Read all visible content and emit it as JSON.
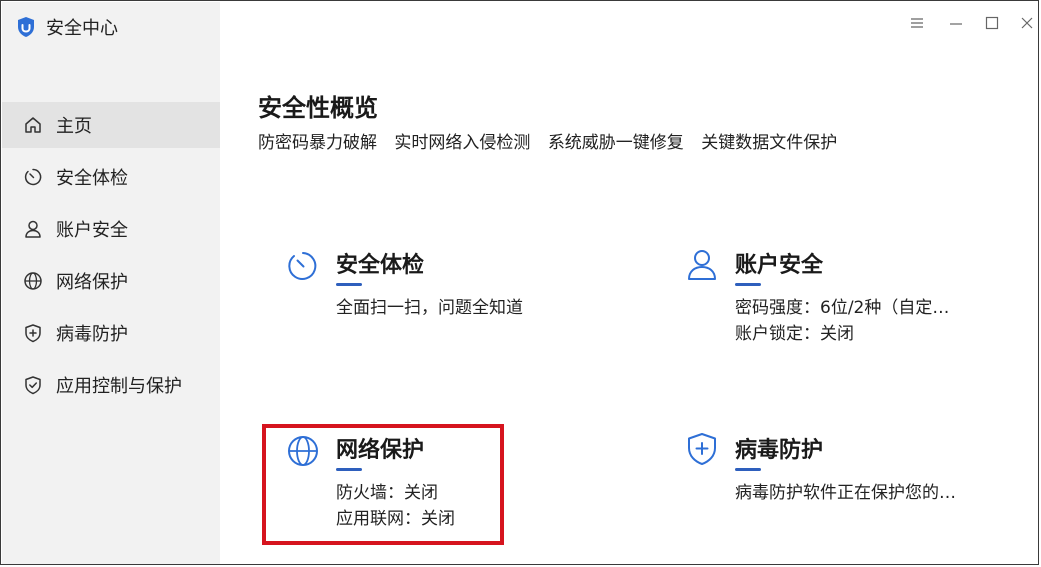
{
  "app": {
    "name": "安全中心"
  },
  "sidebar": {
    "items": [
      {
        "label": "主页",
        "icon": "home-icon",
        "active": true
      },
      {
        "label": "安全体检",
        "icon": "scan-clock-icon",
        "active": false
      },
      {
        "label": "账户安全",
        "icon": "person-icon",
        "active": false
      },
      {
        "label": "网络保护",
        "icon": "globe-icon",
        "active": false
      },
      {
        "label": "病毒防护",
        "icon": "shield-plus-icon",
        "active": false
      },
      {
        "label": "应用控制与保护",
        "icon": "shield-check-icon",
        "active": false
      }
    ]
  },
  "window_controls": [
    "menu-icon",
    "minimize-icon",
    "maximize-icon",
    "close-icon"
  ],
  "main": {
    "title": "安全性概览",
    "features": [
      "防密码暴力破解",
      "实时网络入侵检测",
      "系统威胁一键修复",
      "关键数据文件保护"
    ],
    "cards": {
      "scan": {
        "title": "安全体检",
        "lines": [
          "全面扫一扫，问题全知道"
        ],
        "icon": "scan-clock-icon"
      },
      "account": {
        "title": "账户安全",
        "lines": [
          "密码强度：6位/2种（自定…",
          "账户锁定：关闭"
        ],
        "icon": "person-icon"
      },
      "network": {
        "title": "网络保护",
        "lines": [
          "防火墙：关闭",
          "应用联网：关闭"
        ],
        "icon": "globe-icon"
      },
      "virus": {
        "title": "病毒防护",
        "lines": [
          "病毒防护软件正在保护您的…"
        ],
        "icon": "shield-plus-icon"
      }
    }
  },
  "colors": {
    "accent": "#2e5fbd",
    "icon_blue": "#2e6fd6",
    "highlight_border": "#d6141e",
    "sidebar_bg": "#f2f2f2"
  }
}
